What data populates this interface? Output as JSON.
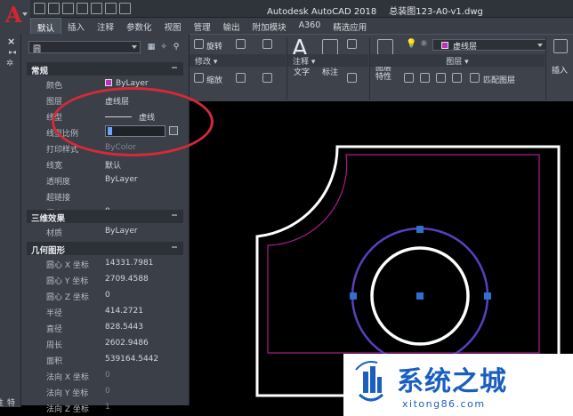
{
  "title_bar": {
    "app": "Autodesk AutoCAD 2018",
    "file": "总装图123-A0-v1.dwg"
  },
  "ribbon_tabs": [
    "默认",
    "插入",
    "注释",
    "参数化",
    "视图",
    "管理",
    "输出",
    "附加模块",
    "A360",
    "精选应用"
  ],
  "ribbon": {
    "modify": {
      "rotate": "旋转",
      "mirror": "镜像",
      "scale": "缩放",
      "footer": "修改"
    },
    "annotation": {
      "text": "文字",
      "dimension": "标注",
      "footer": "注释"
    },
    "layers": {
      "current_layer": "虚线层",
      "layer_properties": "图层特性",
      "make_current": "置为当前",
      "match_layer": "匹配图层",
      "footer": "图层"
    },
    "insert_label": "插入"
  },
  "palette": {
    "selection": "圆",
    "side_label": "特性",
    "sections": {
      "general": "常规",
      "three_d": "三维效果",
      "geometry": "几何图形"
    },
    "general_rows": [
      {
        "k": "颜色",
        "v": "ByLayer"
      },
      {
        "k": "图层",
        "v": "虚线层"
      },
      {
        "k": "线型",
        "v": "虚线"
      },
      {
        "k": "线型比例",
        "v": ""
      },
      {
        "k": "打印样式",
        "v": "ByColor"
      },
      {
        "k": "线宽",
        "v": "默认"
      },
      {
        "k": "透明度",
        "v": "ByLayer"
      },
      {
        "k": "超链接",
        "v": ""
      },
      {
        "k": "厚度",
        "v": "0"
      }
    ],
    "three_d_rows": [
      {
        "k": "材质",
        "v": "ByLayer"
      }
    ],
    "geometry_rows": [
      {
        "k": "圆心 X 坐标",
        "v": "14331.7981"
      },
      {
        "k": "圆心 Y 坐标",
        "v": "2709.4588"
      },
      {
        "k": "圆心 Z 坐标",
        "v": "0"
      },
      {
        "k": "半径",
        "v": "414.2721"
      },
      {
        "k": "直径",
        "v": "828.5443"
      },
      {
        "k": "周长",
        "v": "2602.9486"
      },
      {
        "k": "面积",
        "v": "539164.5442"
      },
      {
        "k": "法向 X 坐标",
        "v": "0"
      },
      {
        "k": "法向 Y 坐标",
        "v": "0"
      },
      {
        "k": "法向 Z 坐标",
        "v": "1"
      }
    ]
  },
  "watermark": {
    "title": "系统之城",
    "url": "xitong86.com"
  },
  "colors": {
    "bylayer_swatch": "#c02fc0",
    "circle_outer": "#5b3fc0",
    "highlight": "#d42a3a",
    "watermark": "#1a5fbf"
  }
}
